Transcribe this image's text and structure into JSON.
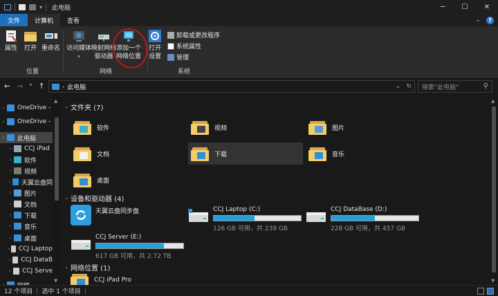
{
  "window": {
    "title": "此电脑"
  },
  "tabs": [
    {
      "label": "文件"
    },
    {
      "label": "计算机"
    },
    {
      "label": "查看"
    }
  ],
  "ribbon": {
    "groups": [
      {
        "label": "位置",
        "buttons": [
          "属性",
          "打开",
          "重命名"
        ]
      },
      {
        "label": "网络",
        "buttons": [
          "访问媒体",
          "映射网络\n驱动器",
          "添加一个\n网络位置"
        ]
      },
      {
        "label": "系统",
        "buttons": [
          "打开\n设置"
        ],
        "small": [
          "卸载或更改程序",
          "系统属性",
          "管理"
        ]
      }
    ]
  },
  "address": {
    "crumb": "此电脑",
    "search_placeholder": "搜索\"此电脑\""
  },
  "navpane": [
    {
      "label": "OneDrive -",
      "icon": "cloud-icon",
      "color": "#3a8fd8",
      "selected": false
    },
    {
      "label": "OneDrive -",
      "icon": "cloud-icon",
      "color": "#3a8fd8",
      "selected": false
    },
    {
      "label": "此电脑",
      "icon": "pc-icon",
      "color": "#3a8fd8",
      "selected": true
    },
    {
      "label": "CCJ iPad",
      "icon": "device-icon",
      "color": "#9aa4b0",
      "selected": false
    },
    {
      "label": "软件",
      "icon": "folder-icon",
      "color": "#3ab0c8",
      "selected": false
    },
    {
      "label": "视频",
      "icon": "video-icon",
      "color": "#7a7a7a",
      "selected": false
    },
    {
      "label": "天翼云盘同",
      "icon": "sync-icon",
      "color": "#2d8fd6",
      "selected": false
    },
    {
      "label": "图片",
      "icon": "pictures-icon",
      "color": "#5a9ad6",
      "selected": false
    },
    {
      "label": "文档",
      "icon": "documents-icon",
      "color": "#cfcfcf",
      "selected": false
    },
    {
      "label": "下载",
      "icon": "download-icon",
      "color": "#3a8fd8",
      "selected": false
    },
    {
      "label": "音乐",
      "icon": "music-icon",
      "color": "#3a8fd8",
      "selected": false
    },
    {
      "label": "桌面",
      "icon": "desktop-icon",
      "color": "#3a8fd8",
      "selected": false
    },
    {
      "label": "CCJ Laptop",
      "icon": "drive-icon",
      "color": "#cfcfcf",
      "selected": false
    },
    {
      "label": "CCJ DataB",
      "icon": "drive-icon",
      "color": "#cfcfcf",
      "selected": false
    },
    {
      "label": "CCJ Serve",
      "icon": "drive-icon",
      "color": "#cfcfcf",
      "selected": false
    },
    {
      "label": "网络",
      "icon": "network-icon",
      "color": "#3a8fd8",
      "selected": false
    }
  ],
  "sections": {
    "folders": {
      "title": "文件夹 (7)"
    },
    "drives": {
      "title": "设备和驱动器 (4)"
    },
    "network": {
      "title": "网络位置 (1)"
    }
  },
  "folders": [
    {
      "label": "软件",
      "badge": "#3ab0c8"
    },
    {
      "label": "视频",
      "badge": "#444"
    },
    {
      "label": "图片",
      "badge": "#5a9ad6"
    },
    {
      "label": "文档",
      "badge": "#f2f2f2"
    },
    {
      "label": "下载",
      "badge": "#2d8fd6"
    },
    {
      "label": "音乐",
      "badge": "#2d8fd6"
    },
    {
      "label": "桌面",
      "badge": "#2d8fd6"
    }
  ],
  "drives": [
    {
      "name": "天翼云盘同步盘",
      "size": "",
      "used": null
    },
    {
      "name": "CCJ Laptop (C:)",
      "size": "126 GB 可用，共 238 GB",
      "used": 0.47
    },
    {
      "name": "CCJ DataBase (D:)",
      "size": "228 GB 可用，共 457 GB",
      "used": 0.5
    },
    {
      "name": "CCJ Server (E:)",
      "size": "617 GB 可用，共 2.72 TB",
      "used": 0.78
    }
  ],
  "netlocations": [
    {
      "name": "CCJ iPad Pro"
    }
  ],
  "status": {
    "count": "12 个项目",
    "selected": "选中 1 个项目"
  }
}
